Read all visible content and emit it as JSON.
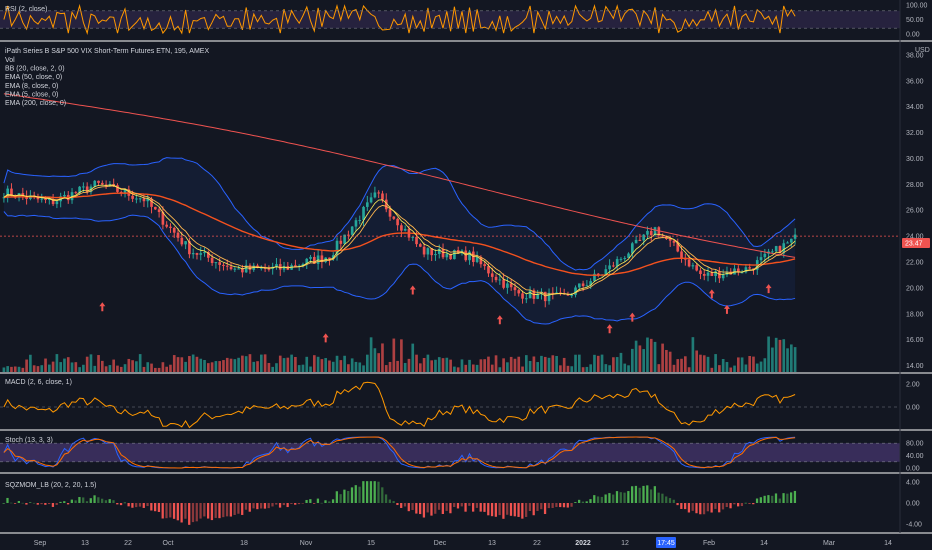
{
  "colors": {
    "background": "#131722",
    "grid": "#1e222d",
    "separator": "#ffffff",
    "up": "#26a69a",
    "down": "#ef5350",
    "ema200": "#ef5350",
    "ema50": "#f4511e",
    "ema8": "#ffb74d",
    "ema5": "#ffee58",
    "bb": "#2962ff",
    "rsi": "#ff9800",
    "macd": "#ff9800",
    "stoch_k": "#2962ff",
    "stoch_d": "#ff6d00",
    "stoch_band": "#7e57c2",
    "sqz_green": "#4caf50",
    "sqz_red": "#ef5350"
  },
  "chart_data": {
    "type": "candlestick",
    "title": "iPath Series B S&P 500 VIX Short-Term Futures ETN, 195, AMEX",
    "legend": [
      "Vol",
      "BB (20, close, 2, 0)",
      "EMA (50, close, 0)",
      "EMA (8, close, 0)",
      "EMA (5, close, 0)",
      "EMA (200, close, 0)"
    ],
    "currency": "USD",
    "price_axis": [
      "38.00",
      "36.00",
      "34.00",
      "32.00",
      "30.00",
      "28.00",
      "26.00",
      "24.00",
      "22.00",
      "20.00",
      "18.00",
      "16.00",
      "14.00"
    ],
    "ylim": [
      13.5,
      39
    ],
    "last_price": "23.47",
    "last_price_level": 24.0,
    "x_labels": [
      "Sep",
      "13",
      "22",
      "Oct",
      "18",
      "Nov",
      "15",
      "Dec",
      "13",
      "22",
      "2022",
      "12",
      "17:45",
      "Feb",
      "14",
      "Mar",
      "14"
    ],
    "price_path": [
      {
        "x": "Sep start",
        "y": 27.4
      },
      {
        "x": "Sep 13",
        "y": 26.6
      },
      {
        "x": "Sep 22",
        "y": 28.0
      },
      {
        "x": "Oct",
        "y": 26.9
      },
      {
        "x": "Oct 18",
        "y": 22.9
      },
      {
        "x": "Nov",
        "y": 21.4
      },
      {
        "x": "Nov 15",
        "y": 21.5
      },
      {
        "x": "Dec",
        "y": 22.5
      },
      {
        "x": "Dec early",
        "y": 27.2
      },
      {
        "x": "Dec 13",
        "y": 22.8
      },
      {
        "x": "Dec 22",
        "y": 22.5
      },
      {
        "x": "2022",
        "y": 19.6
      },
      {
        "x": "Jan 12",
        "y": 19.2
      },
      {
        "x": "17:45",
        "y": 21.5
      },
      {
        "x": "Jan end",
        "y": 24.6
      },
      {
        "x": "Feb",
        "y": 20.9
      },
      {
        "x": "Feb 14",
        "y": 21.5
      },
      {
        "x": "Feb end",
        "y": 23.8
      }
    ],
    "rsi": {
      "label": "RSI (2, close)",
      "axis": [
        "100.00",
        "50.00",
        "0.00"
      ],
      "band": [
        20,
        80
      ]
    },
    "macd": {
      "label": "MACD (2, 6, close, 1)",
      "axis": [
        "2.00",
        "0.00"
      ]
    },
    "stoch": {
      "label": "Stoch (13, 3, 3)",
      "axis": [
        "80.00",
        "40.00",
        "0.00"
      ],
      "band": [
        20,
        80
      ]
    },
    "sqzmom": {
      "label": "SQZMOM_LB (20, 2, 20, 1.5)",
      "axis": [
        "4.00",
        "0.00",
        "-4.00"
      ]
    }
  }
}
